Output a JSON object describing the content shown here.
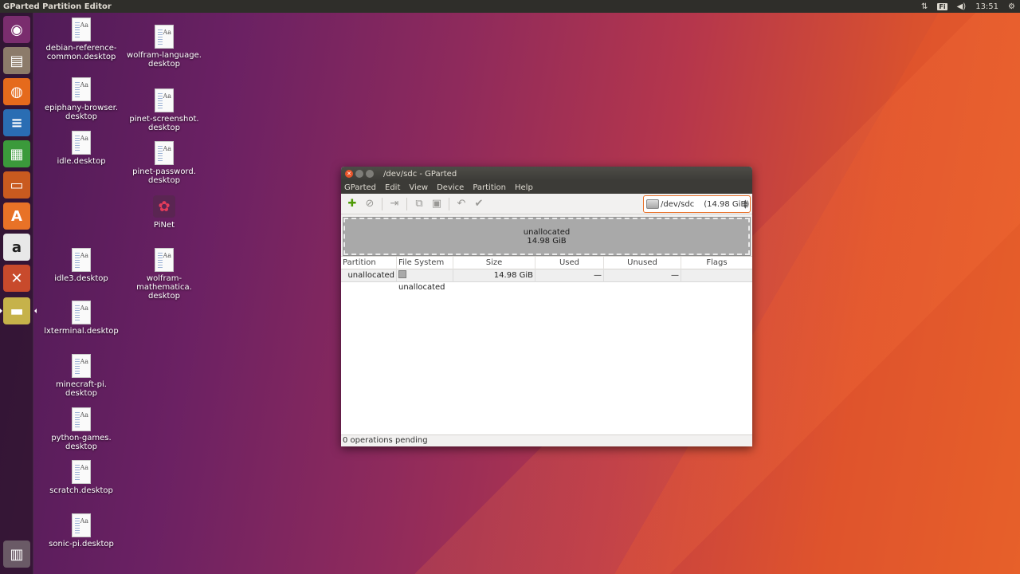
{
  "top_panel": {
    "app_title": "GParted Partition Editor",
    "keyboard_layout": "Fi",
    "clock": "13:51"
  },
  "launcher": {
    "items": [
      {
        "name": "Ubuntu dash",
        "icon": "ubuntu-logo-icon",
        "glyph": "◉",
        "color": "#7a2d6e"
      },
      {
        "name": "Files",
        "icon": "file-manager-icon",
        "glyph": "▤",
        "color": "#8c7b6a"
      },
      {
        "name": "Firefox",
        "icon": "firefox-icon",
        "glyph": "◍",
        "color": "#e56a1c"
      },
      {
        "name": "LibreOffice Writer",
        "icon": "writer-icon",
        "glyph": "≡",
        "color": "#2a6db3"
      },
      {
        "name": "LibreOffice Calc",
        "icon": "calc-icon",
        "glyph": "▦",
        "color": "#3b9a3b"
      },
      {
        "name": "LibreOffice Impress",
        "icon": "impress-icon",
        "glyph": "▭",
        "color": "#c95a1f"
      },
      {
        "name": "Ubuntu Software",
        "icon": "software-center-icon",
        "glyph": "A",
        "color": "#e87227"
      },
      {
        "name": "Amazon",
        "icon": "amazon-icon",
        "glyph": "a",
        "color": "#e8e8e8"
      },
      {
        "name": "System Settings",
        "icon": "settings-icon",
        "glyph": "✕",
        "color": "#c84a2c"
      },
      {
        "name": "GParted",
        "icon": "gparted-icon",
        "glyph": "▬",
        "color": "#c6b24a"
      },
      {
        "name": "Trash",
        "icon": "trash-icon",
        "glyph": "▥",
        "color": "#6a5a66"
      }
    ]
  },
  "desktop": {
    "col1": [
      "debian-reference-\ncommon.desktop",
      "epiphany-browser.\ndesktop",
      "idle.desktop",
      "idle3.desktop",
      "lxterminal.desktop",
      "minecraft-pi.\ndesktop",
      "python-games.\ndesktop",
      "scratch.desktop",
      "sonic-pi.desktop"
    ],
    "col2": [
      "wolfram-language.\ndesktop",
      "pinet-screenshot.\ndesktop",
      "pinet-password.\ndesktop",
      "PiNet",
      "wolfram-\nmathematica.\ndesktop"
    ]
  },
  "window": {
    "title": "/dev/sdc - GParted",
    "menu": [
      "GParted",
      "Edit",
      "View",
      "Device",
      "Partition",
      "Help"
    ],
    "device_selector": {
      "device": "/dev/sdc",
      "size": "(14.98 GiB)"
    },
    "disk_graphic": {
      "label": "unallocated",
      "size": "14.98 GiB"
    },
    "table": {
      "headers": [
        "Partition",
        "File System",
        "Size",
        "Used",
        "Unused",
        "Flags"
      ],
      "rows": [
        {
          "partition": "unallocated",
          "filesystem": "unallocated",
          "size": "14.98 GiB",
          "used": "—",
          "unused": "—",
          "flags": ""
        }
      ]
    },
    "status": "0 operations pending"
  }
}
